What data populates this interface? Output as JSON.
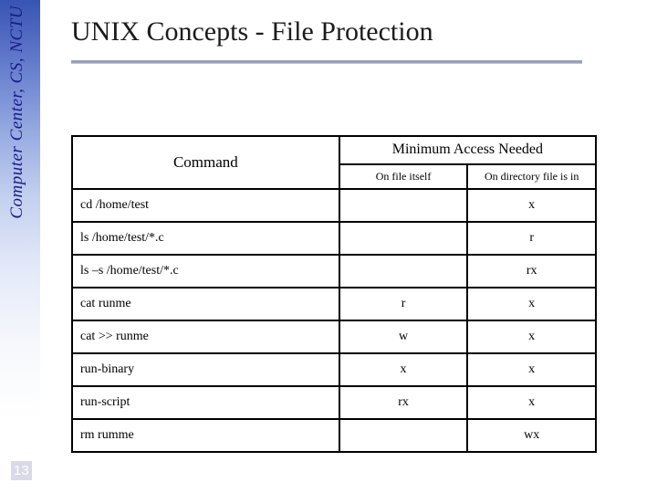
{
  "sidebar_label": "Computer Center, CS, NCTU",
  "page_number": "13",
  "title": "UNIX Concepts - File Protection",
  "table": {
    "header_command": "Command",
    "header_min_access": "Minimum Access Needed",
    "header_on_file": "On file itself",
    "header_on_dir": "On directory file is in",
    "rows": [
      {
        "cmd": "cd /home/test",
        "file": "",
        "dir": "x"
      },
      {
        "cmd": "ls /home/test/*.c",
        "file": "",
        "dir": "r"
      },
      {
        "cmd": "ls –s /home/test/*.c",
        "file": "",
        "dir": "rx"
      },
      {
        "cmd": "cat runme",
        "file": "r",
        "dir": "x"
      },
      {
        "cmd": "cat >> runme",
        "file": "w",
        "dir": "x"
      },
      {
        "cmd": "run-binary",
        "file": "x",
        "dir": "x"
      },
      {
        "cmd": "run-script",
        "file": "rx",
        "dir": "x"
      },
      {
        "cmd": "rm rumme",
        "file": "",
        "dir": "wx"
      }
    ]
  }
}
